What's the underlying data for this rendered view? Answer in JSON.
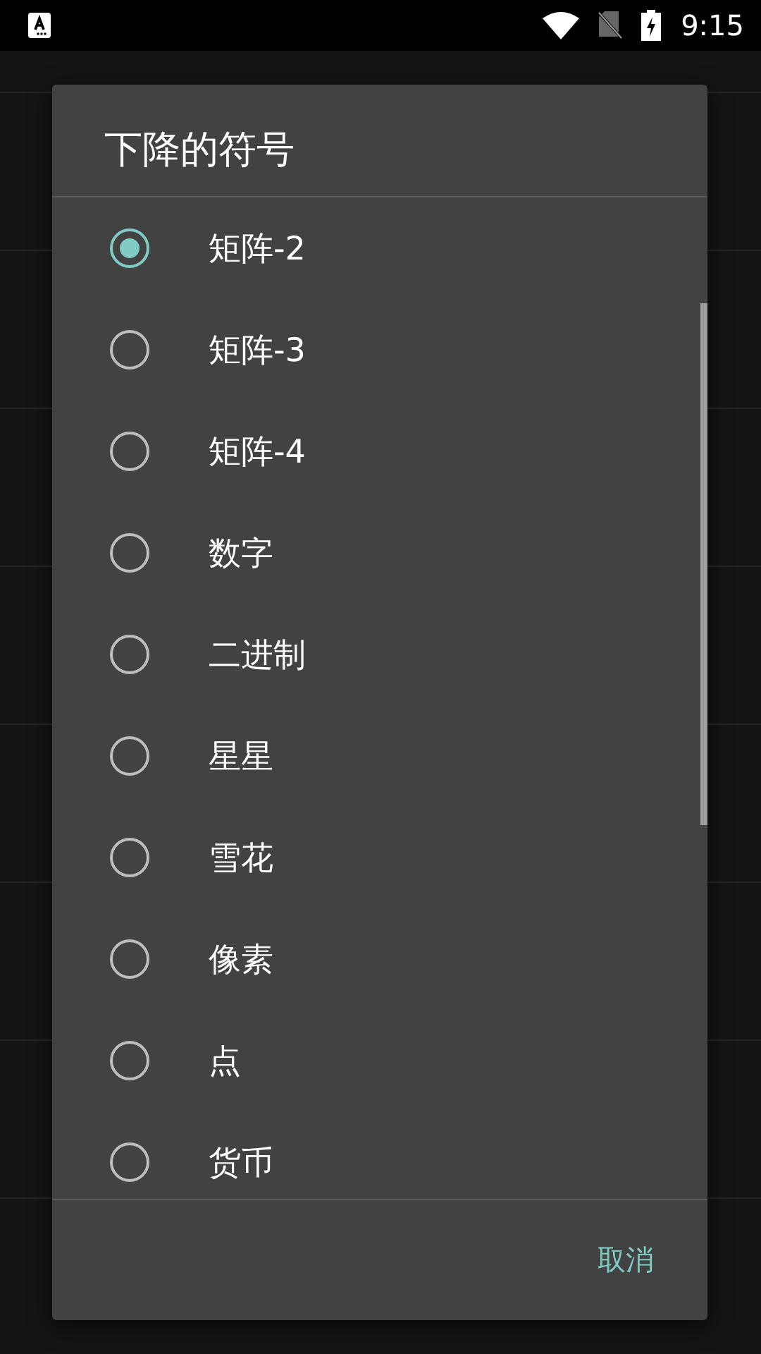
{
  "status_bar": {
    "time": "9:15"
  },
  "dialog": {
    "title": "下降的符号",
    "options": [
      {
        "label": "矩阵-2",
        "selected": true
      },
      {
        "label": "矩阵-3",
        "selected": false
      },
      {
        "label": "矩阵-4",
        "selected": false
      },
      {
        "label": "数字",
        "selected": false
      },
      {
        "label": "二进制",
        "selected": false
      },
      {
        "label": "星星",
        "selected": false
      },
      {
        "label": "雪花",
        "selected": false
      },
      {
        "label": "像素",
        "selected": false
      },
      {
        "label": "点",
        "selected": false
      },
      {
        "label": "货币",
        "selected": false
      }
    ],
    "button": "取消"
  }
}
